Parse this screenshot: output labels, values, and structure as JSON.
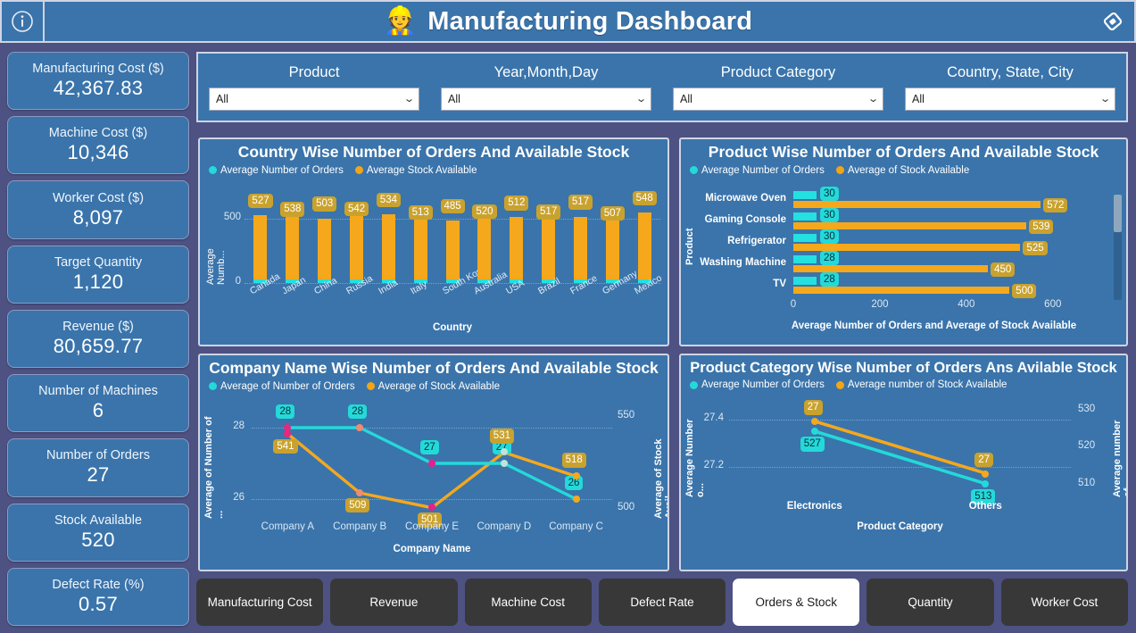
{
  "header": {
    "info_icon": "info-circle-icon",
    "worker_emoji": "👷",
    "title": "Manufacturing Dashboard",
    "eraser_icon": "eraser-icon"
  },
  "kpis": [
    {
      "label": "Manufacturing Cost ($)",
      "value": "42,367.83"
    },
    {
      "label": "Machine Cost ($)",
      "value": "10,346"
    },
    {
      "label": "Worker Cost ($)",
      "value": "8,097"
    },
    {
      "label": "Target Quantity",
      "value": "1,120"
    },
    {
      "label": "Revenue ($)",
      "value": "80,659.77"
    },
    {
      "label": "Number of Machines",
      "value": "6"
    },
    {
      "label": "Number of Orders",
      "value": "27"
    },
    {
      "label": "Stock Available",
      "value": "520"
    },
    {
      "label": "Defect Rate (%)",
      "value": "0.57"
    }
  ],
  "filters": [
    {
      "label": "Product",
      "value": "All"
    },
    {
      "label": "Year,Month,Day",
      "value": "All"
    },
    {
      "label": "Product Category",
      "value": "All"
    },
    {
      "label": "Country, State, City",
      "value": "All"
    }
  ],
  "tabs": [
    {
      "label": "Manufacturing Cost",
      "active": false
    },
    {
      "label": "Revenue",
      "active": false
    },
    {
      "label": "Machine Cost",
      "active": false
    },
    {
      "label": "Defect Rate",
      "active": false
    },
    {
      "label": "Orders & Stock",
      "active": true
    },
    {
      "label": "Quantity",
      "active": false
    },
    {
      "label": "Worker Cost",
      "active": false
    }
  ],
  "colors": {
    "page_background": "#4d5283",
    "panel_background": "#3a74ab",
    "header_background": "#3a74ab",
    "series_orders": "#24d9d9",
    "series_stock": "#f5a81c",
    "label_gold": "#c9a22e",
    "tab_inactive": "#383838",
    "tab_active": "#ffffff"
  },
  "chart_data": [
    {
      "id": "country-chart",
      "type": "bar",
      "title": "Country Wise Number of Orders And Available Stock",
      "xlabel": "Country",
      "ylabel": "Average Numb...",
      "legend": [
        "Average Number of Orders",
        "Average Stock Available"
      ],
      "legend_position": "top-left",
      "grid": true,
      "yticks": [
        "0",
        "500"
      ],
      "ylim": [
        0,
        600
      ],
      "categories": [
        "Canada",
        "Japan",
        "China",
        "Russia",
        "India",
        "Italy",
        "South Korea",
        "Australia",
        "USA",
        "Brazil",
        "France",
        "Germany",
        "Mexico"
      ],
      "series": [
        {
          "name": "Average Stock Available",
          "values": [
            527,
            538,
            503,
            542,
            534,
            513,
            485,
            520,
            512,
            517,
            517,
            507,
            548
          ]
        },
        {
          "name": "Average Number of Orders",
          "values": [
            28,
            27,
            27,
            28,
            27,
            27,
            26,
            27,
            27,
            27,
            27,
            27,
            28
          ]
        }
      ]
    },
    {
      "id": "product-chart",
      "type": "bar",
      "orientation": "horizontal",
      "title": "Product Wise Number of Orders And Available Stock",
      "xlabel": "Average Number of Orders and Average of Stock Available",
      "ylabel": "Product",
      "legend": [
        "Average Number of Orders",
        "Average of Stock Available"
      ],
      "legend_position": "top-left",
      "xticks": [
        "0",
        "200",
        "400",
        "600"
      ],
      "xlim": [
        0,
        650
      ],
      "categories": [
        "Microwave Oven",
        "Gaming Console",
        "Refrigerator",
        "Washing Machine",
        "TV"
      ],
      "series": [
        {
          "name": "Average Number of Orders",
          "values": [
            30,
            30,
            30,
            28,
            28
          ]
        },
        {
          "name": "Average of Stock Available",
          "values": [
            572,
            539,
            525,
            450,
            500
          ]
        }
      ],
      "has_scrollbar": true
    },
    {
      "id": "company-chart",
      "type": "line",
      "title": "Company Name Wise Number of Orders And Available Stock",
      "xlabel": "Company Name",
      "ylabel": "Average of Number of ...",
      "y2label": "Average of Stock Avail...",
      "legend": [
        "Average of Number of Orders",
        "Average of Stock Available"
      ],
      "legend_position": "top-left",
      "grid": true,
      "yticks": [
        "26",
        "28"
      ],
      "ylim": [
        25.5,
        28.6
      ],
      "y2ticks": [
        "500",
        "550"
      ],
      "y2lim": [
        496,
        556
      ],
      "categories": [
        "Company A",
        "Company B",
        "Company E",
        "Company D",
        "Company C"
      ],
      "series": [
        {
          "name": "Average of Number of Orders",
          "axis": "left",
          "values": [
            28,
            28,
            27,
            27,
            26
          ]
        },
        {
          "name": "Average of Stock Available",
          "axis": "right",
          "values": [
            541,
            509,
            501,
            531,
            518
          ]
        }
      ]
    },
    {
      "id": "category-chart",
      "type": "line",
      "title": "Product Category Wise Number of Orders Ans Avilable Stock",
      "xlabel": "Product Category",
      "ylabel": "Average Number o...",
      "y2label": "Average number of...",
      "legend": [
        "Average Number of Orders",
        "Average number of Stock Available"
      ],
      "legend_position": "top-left",
      "grid": true,
      "yticks": [
        "27.2",
        "27.4"
      ],
      "ylim": [
        27.08,
        27.47
      ],
      "y2ticks": [
        "510",
        "520",
        "530"
      ],
      "y2lim": [
        507,
        532
      ],
      "categories": [
        "Electronics",
        "Others"
      ],
      "series": [
        {
          "name": "Average Number of Orders",
          "axis": "left",
          "values": [
            27.35,
            27.13
          ],
          "labels": [
            "527",
            "513"
          ]
        },
        {
          "name": "Average number of Stock Available",
          "axis": "right",
          "values": [
            527,
            513
          ],
          "labels": [
            "27",
            "27"
          ]
        }
      ]
    }
  ]
}
